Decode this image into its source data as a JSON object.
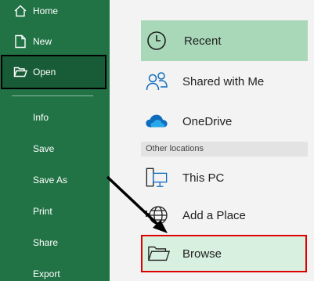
{
  "colors": {
    "sidebar_bg": "#217346",
    "sidebar_selected_bg": "#185c37",
    "recent_bg": "#a9d8b8",
    "browse_bg": "#d8f0e0",
    "highlight": "#e00000",
    "onedrive_blue": "#0f6cbd"
  },
  "sidebar": {
    "items": [
      {
        "label": "Home",
        "icon": "home-icon"
      },
      {
        "label": "New",
        "icon": "new-document-icon"
      },
      {
        "label": "Open",
        "icon": "open-folder-icon",
        "selected": true
      },
      {
        "label": "Info"
      },
      {
        "label": "Save"
      },
      {
        "label": "Save As"
      },
      {
        "label": "Print"
      },
      {
        "label": "Share"
      },
      {
        "label": "Export"
      }
    ]
  },
  "locations": {
    "items": [
      {
        "label": "Recent",
        "icon": "clock-icon",
        "selected": true
      },
      {
        "label": "Shared with Me",
        "icon": "people-icon"
      },
      {
        "label": "OneDrive",
        "icon": "cloud-icon"
      }
    ],
    "section_header": "Other locations",
    "other": [
      {
        "label": "This PC",
        "icon": "computer-icon"
      },
      {
        "label": "Add a Place",
        "icon": "globe-plus-icon"
      },
      {
        "label": "Browse",
        "icon": "folder-icon",
        "highlighted": true
      }
    ]
  }
}
